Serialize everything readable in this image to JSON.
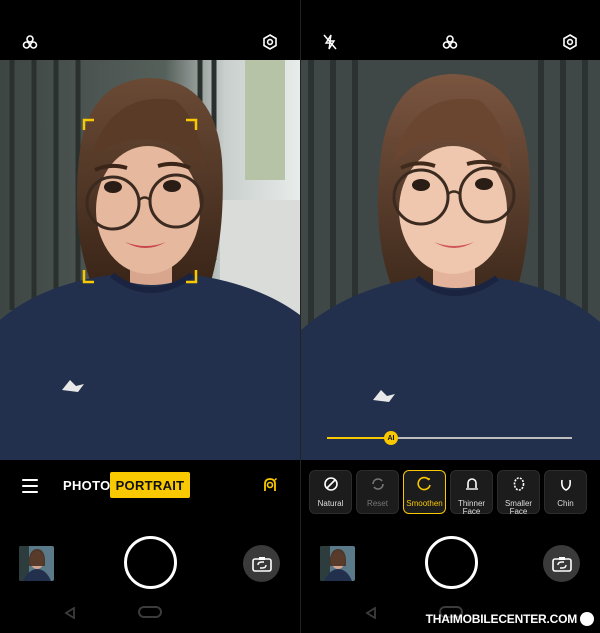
{
  "left_screen": {
    "mode_bar": {
      "photo_label": "PHOTO",
      "portrait_label": "PORTRAIT"
    },
    "icons": {
      "top_center": "filter-icon",
      "top_right": "settings-icon",
      "menu": "menu-icon",
      "beauty": "beauty-icon",
      "switch_camera": "switch-camera-icon"
    }
  },
  "right_screen": {
    "icons": {
      "top_left": "flash-off-icon",
      "top_center": "filter-icon",
      "top_right": "settings-icon",
      "switch_camera": "switch-camera-icon"
    },
    "slider": {
      "knob_label": "AI",
      "level": 0.26
    },
    "beauty_options": [
      {
        "label": "Natural",
        "icon": "natural-icon",
        "state": "normal"
      },
      {
        "label": "Reset",
        "icon": "reset-icon",
        "state": "disabled"
      },
      {
        "label": "Smoothen",
        "icon": "smoothen-icon",
        "state": "active"
      },
      {
        "label": "Thinner Face",
        "icon": "thinner-face-icon",
        "state": "normal"
      },
      {
        "label": "Smaller Face",
        "icon": "smaller-face-icon",
        "state": "normal"
      },
      {
        "label": "Chin",
        "icon": "chin-icon",
        "state": "normal"
      }
    ]
  },
  "watermark": {
    "text": "THAIMOBILECENTER.COM"
  },
  "colors": {
    "accent": "#f8c800",
    "background": "#000000",
    "sweater": "#23304d"
  }
}
